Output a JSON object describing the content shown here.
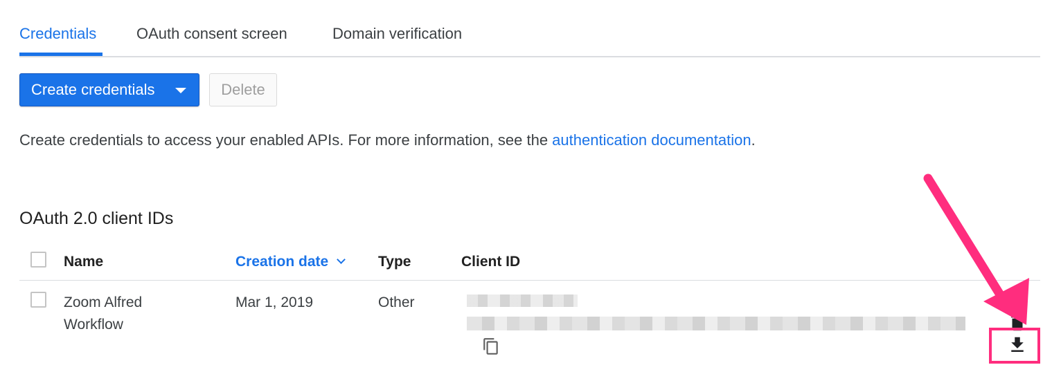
{
  "tabs": [
    {
      "label": "Credentials",
      "active": true
    },
    {
      "label": "OAuth consent screen",
      "active": false
    },
    {
      "label": "Domain verification",
      "active": false
    }
  ],
  "toolbar": {
    "create_label": "Create credentials",
    "delete_label": "Delete"
  },
  "info": {
    "text": "Create credentials to access your enabled APIs. For more information, see the ",
    "link_text": "authentication documentation",
    "suffix": "."
  },
  "section": {
    "title": "OAuth 2.0 client IDs"
  },
  "table": {
    "columns": {
      "name": "Name",
      "creation_date": "Creation date",
      "type": "Type",
      "client_id": "Client ID"
    },
    "sorted_column": "creation_date",
    "rows": [
      {
        "name_line1": "Zoom Alfred",
        "name_line2": "Workflow",
        "creation_date": "Mar 1, 2019",
        "type": "Other",
        "client_id_redacted": true
      }
    ]
  },
  "icons": {
    "sort": "chevron-down-icon",
    "copy": "copy-icon",
    "edit": "pencil-icon",
    "delete": "trash-icon",
    "download": "download-icon"
  },
  "colors": {
    "accent": "#1a73e8",
    "annotation": "#ff2d7e"
  }
}
